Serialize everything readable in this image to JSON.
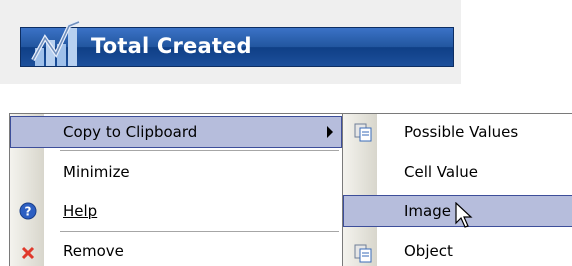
{
  "header": {
    "title": "Total Created",
    "icon": "line-chart-icon"
  },
  "context_menu": {
    "items": [
      {
        "label": "Copy to Clipboard",
        "highlighted": true,
        "has_submenu": true
      },
      {
        "label": "Minimize"
      },
      {
        "label": "Help",
        "icon": "help-icon",
        "mnemonic": "H"
      },
      {
        "label": "Remove",
        "icon": "remove-icon"
      }
    ]
  },
  "submenu": {
    "items": [
      {
        "label": "Possible Values",
        "icon": "copy-icon"
      },
      {
        "label": "Cell Value"
      },
      {
        "label": "Image",
        "highlighted": true
      },
      {
        "label": "Object",
        "icon": "copy-icon"
      }
    ]
  },
  "colors": {
    "header_blue": "#22569f",
    "highlight": "#b6bddc",
    "highlight_border": "#3d4e9a"
  }
}
